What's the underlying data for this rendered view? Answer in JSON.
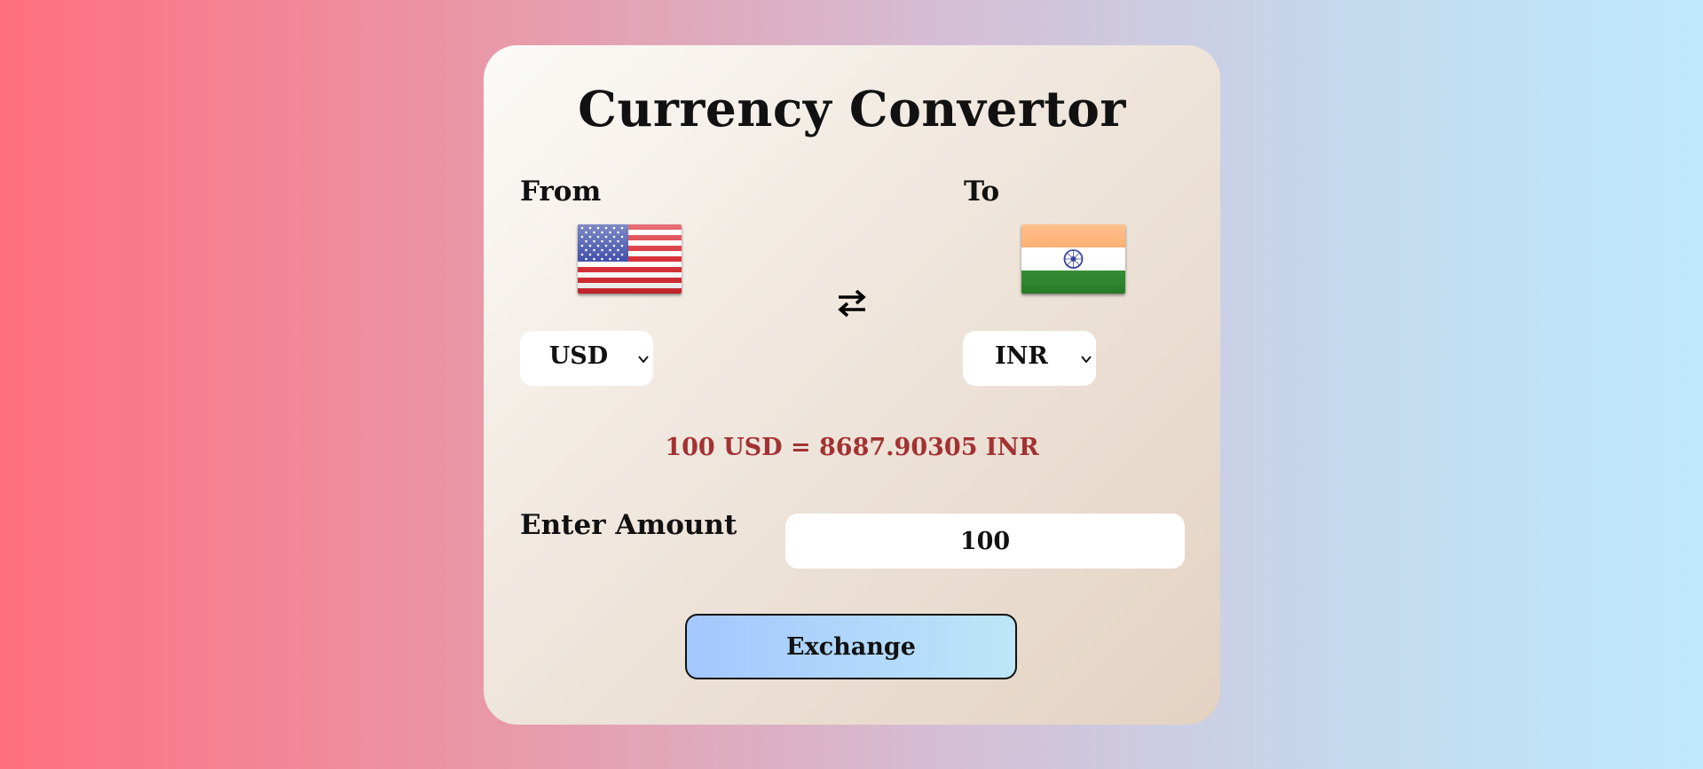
{
  "app": {
    "title": "Currency Convertor"
  },
  "from": {
    "label": "From",
    "currency": "USD",
    "flag_icon": "us-flag-icon"
  },
  "to": {
    "label": "To",
    "currency": "INR",
    "flag_icon": "india-flag-icon"
  },
  "swap": {
    "icon": "swap-arrows-icon"
  },
  "result": {
    "text": "100 USD = 8687.90305 INR",
    "color": "#a23232"
  },
  "amount": {
    "label": "Enter Amount",
    "value": "100"
  },
  "exchange_button": {
    "label": "Exchange"
  }
}
